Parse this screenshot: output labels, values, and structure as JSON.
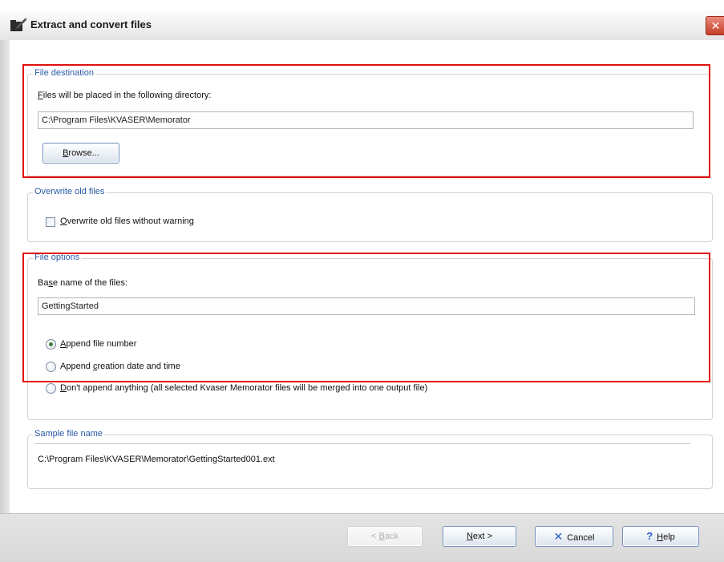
{
  "window": {
    "title": "Extract and convert files",
    "title_icon": "folder-pencil-icon",
    "close_label": "✕"
  },
  "file_destination": {
    "legend": "File destination",
    "label_prefix": "",
    "label_mnemonic": "F",
    "label_rest": "iles will be placed in the following directory:",
    "directory_value": "C:\\Program Files\\KVASER\\Memorator",
    "browse_mnemonic": "B",
    "browse_rest": "rowse..."
  },
  "overwrite": {
    "legend": "Overwrite old files",
    "checkbox_mnemonic": "O",
    "checkbox_rest": "verwrite old files without warning",
    "checked": false
  },
  "file_options": {
    "legend": "File options",
    "label_prefix": "Ba",
    "label_mnemonic": "s",
    "label_rest": "e name of the files:",
    "base_name_value": "GettingStarted",
    "radios": [
      {
        "prefix": "",
        "mnemonic": "A",
        "rest": "ppend file number",
        "checked": true
      },
      {
        "prefix": "Append ",
        "mnemonic": "c",
        "rest": "reation date and time",
        "checked": false
      },
      {
        "prefix": "",
        "mnemonic": "D",
        "rest": "on't append anything (all selected Kvaser Memorator files will be merged into one output file)",
        "checked": false
      }
    ]
  },
  "sample": {
    "legend": "Sample file name",
    "value": "C:\\Program Files\\KVASER\\Memorator\\GettingStarted001.ext"
  },
  "buttons": {
    "back": {
      "prefix": "< ",
      "mnemonic": "B",
      "rest": "ack"
    },
    "next": {
      "prefix": "",
      "mnemonic": "N",
      "rest": "ext >"
    },
    "cancel": {
      "icon": "✕",
      "label": "Cancel"
    },
    "help": {
      "icon": "?",
      "mnemonic": "H",
      "rest": "elp"
    }
  },
  "colors": {
    "highlight": "#e01010",
    "legend_text": "#2a5aa8"
  }
}
